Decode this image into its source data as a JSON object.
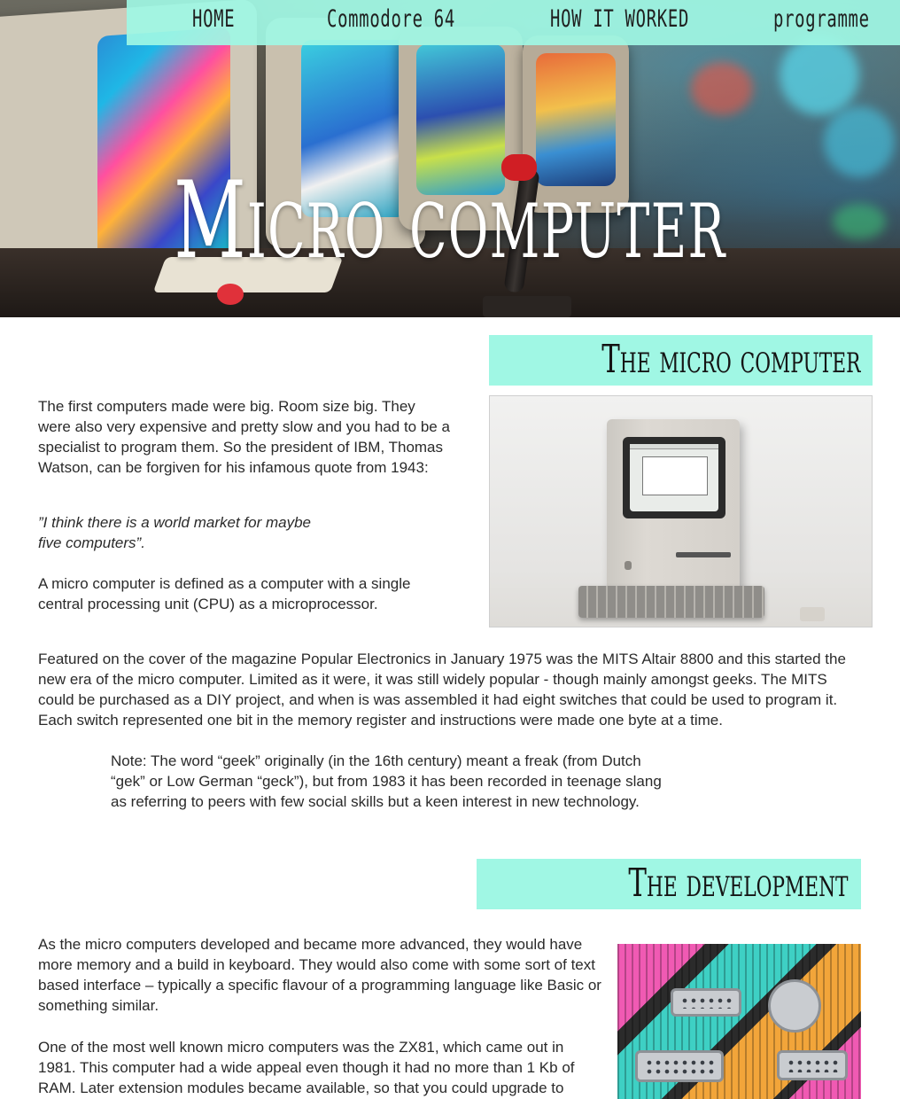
{
  "nav": {
    "items": [
      "HOME",
      "Commodore 64",
      "HOW IT WORKED",
      "programme"
    ]
  },
  "hero": {
    "title": "Micro computer"
  },
  "sections": {
    "micro": {
      "heading": "The micro computer",
      "p1": "The first computers made were big. Room size big. They were also very expensive and pretty slow and you had to be a specialist to program them. So the president of IBM, Thomas Watson, can be forgiven for his infamous quote from 1943:",
      "quote": "”I think there is a world market for maybe five computers”.",
      "p2": "A micro computer is defined as a computer with a single central processing unit (CPU) as a microprocessor.",
      "p3": "Featured on the cover of the magazine Popular Electronics in January 1975 was the MITS Altair 8800 and this started the new era of the micro computer. Limited as it were, it was still widely popular - though mainly amongst geeks. The MITS could be purchased as a DIY project, and when is was assembled it had eight switches that could be used to program it. Each switch represented one bit in the memory register and instructions were made one byte at a time.",
      "note": "Note: The word “geek” originally (in the 16th century) meant a freak (from Dutch “gek” or Low German “geck”), but from 1983 it has been recorded in teenage slang as referring to peers with few social skills but a keen interest in new technology."
    },
    "development": {
      "heading": "The development",
      "p1": "As the micro computers developed and became more advanced, they would have more memory and a build in keyboard. They would also come with some sort of text based interface – typically a specific flavour of a programming language like Basic or something similar.",
      "p2": "One of the most well known micro computers was the ZX81, which came out in 1981. This computer had a wide appeal even though it had no more than 1 Kb of RAM. Later extension modules became available, so that you could upgrade to"
    }
  },
  "colors": {
    "accent": "#a0f7e4",
    "text": "#2a2a2a",
    "hero_title": "#ffffff"
  }
}
